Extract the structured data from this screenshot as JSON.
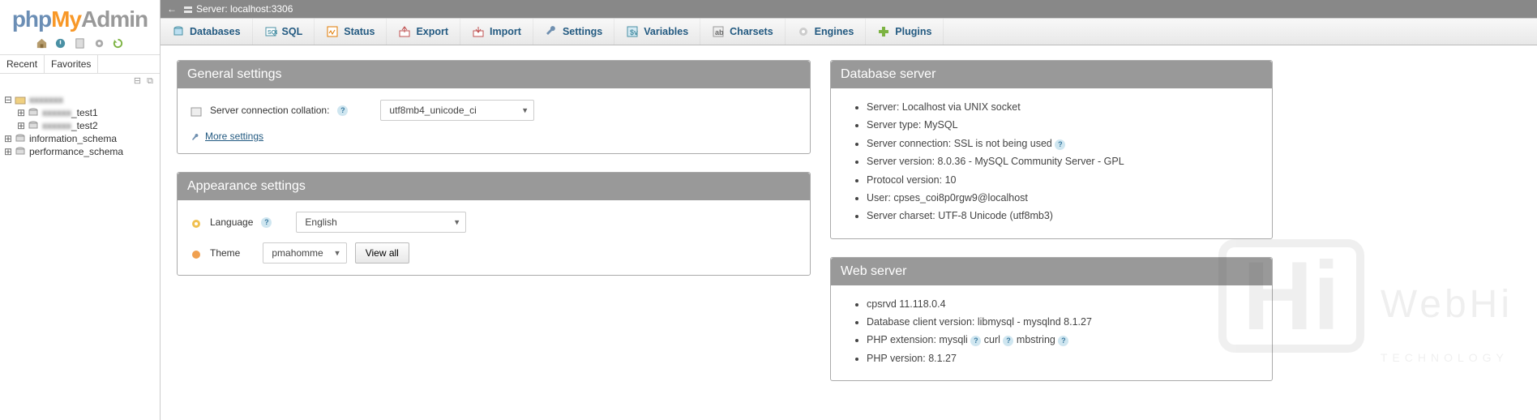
{
  "logo": {
    "php": "php",
    "my": "My",
    "admin": "Admin"
  },
  "sidebar": {
    "tabs": {
      "recent": "Recent",
      "favorites": "Favorites"
    },
    "tree": {
      "root": {
        "label": "[server]"
      },
      "items": [
        {
          "label": "_test1",
          "blurred_prefix": "xxxxxx"
        },
        {
          "label": "_test2",
          "blurred_prefix": "xxxxxx"
        },
        {
          "label": "information_schema"
        },
        {
          "label": "performance_schema"
        }
      ]
    }
  },
  "breadcrumb": {
    "server_label": "Server: localhost:3306"
  },
  "topmenu": [
    {
      "key": "databases",
      "label": "Databases"
    },
    {
      "key": "sql",
      "label": "SQL"
    },
    {
      "key": "status",
      "label": "Status"
    },
    {
      "key": "export",
      "label": "Export"
    },
    {
      "key": "import",
      "label": "Import"
    },
    {
      "key": "settings",
      "label": "Settings"
    },
    {
      "key": "variables",
      "label": "Variables"
    },
    {
      "key": "charsets",
      "label": "Charsets"
    },
    {
      "key": "engines",
      "label": "Engines"
    },
    {
      "key": "plugins",
      "label": "Plugins"
    }
  ],
  "general_settings": {
    "title": "General settings",
    "collation_label": "Server connection collation:",
    "collation_value": "utf8mb4_unicode_ci",
    "more": "More settings"
  },
  "appearance_settings": {
    "title": "Appearance settings",
    "language_label": "Language",
    "language_value": "English",
    "theme_label": "Theme",
    "theme_value": "pmahomme",
    "view_all": "View all"
  },
  "database_server": {
    "title": "Database server",
    "items": [
      "Server: Localhost via UNIX socket",
      "Server type: MySQL",
      "Server connection: SSL is not being used",
      "Server version: 8.0.36 - MySQL Community Server - GPL",
      "Protocol version: 10",
      "User: cpses_coi8p0rgw9@localhost",
      "Server charset: UTF-8 Unicode (utf8mb3)"
    ],
    "help_after_index": 2
  },
  "web_server": {
    "title": "Web server",
    "items": [
      "cpsrvd 11.118.0.4",
      "Database client version: libmysql - mysqlnd 8.1.27",
      "PHP extension: mysqli",
      "PHP version: 8.1.27"
    ],
    "php_ext_tail": [
      "curl",
      "mbstring"
    ]
  }
}
